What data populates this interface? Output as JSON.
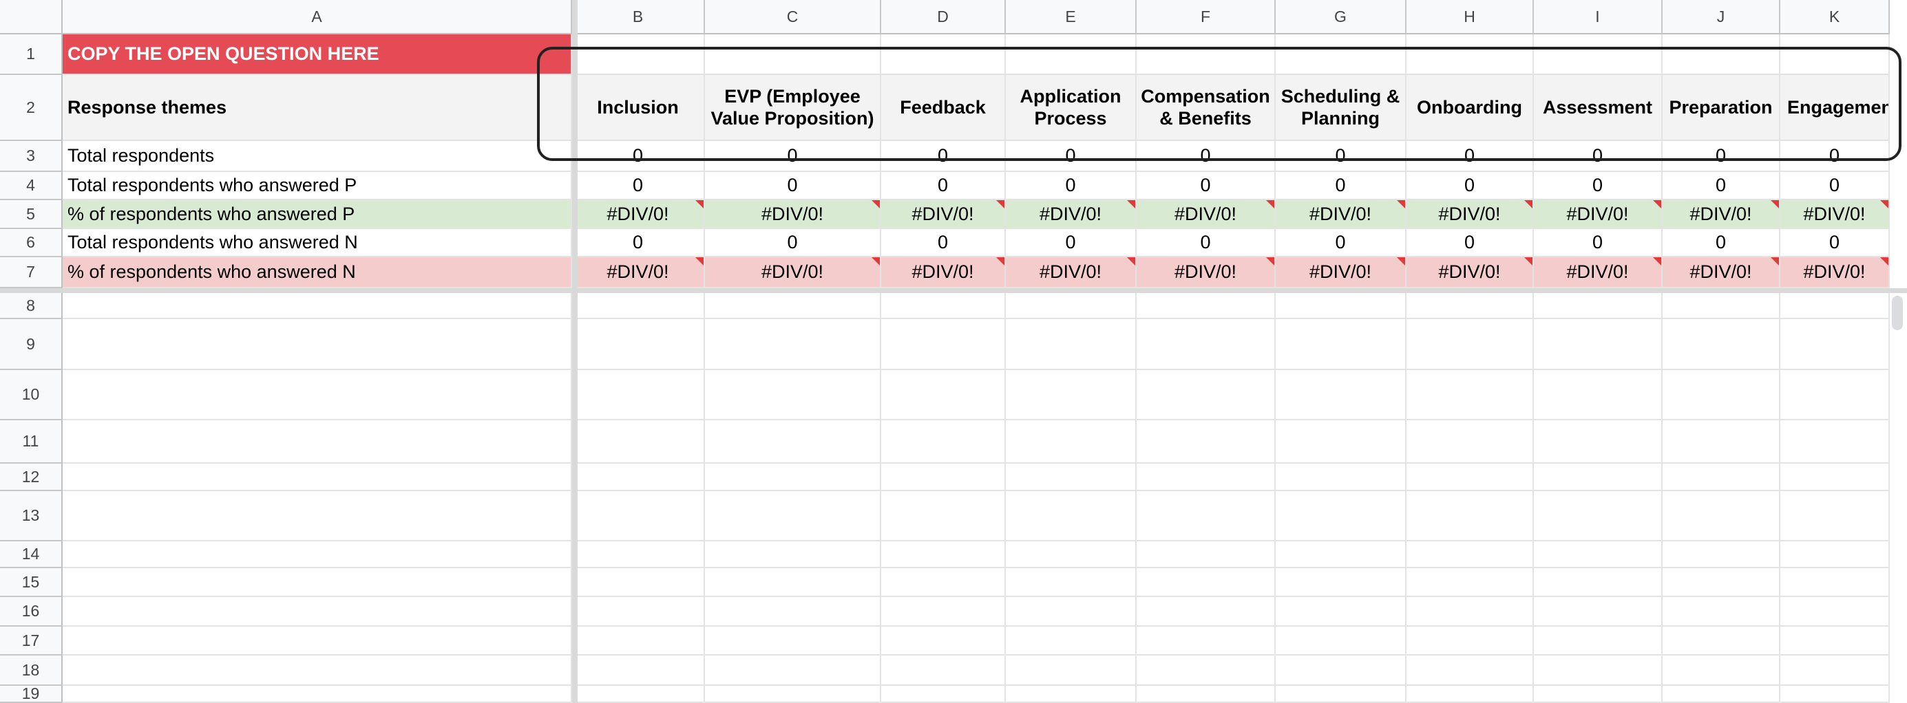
{
  "columns": [
    "A",
    "B",
    "C",
    "D",
    "E",
    "F",
    "G",
    "H",
    "I",
    "J",
    "K"
  ],
  "rows": [
    "1",
    "2",
    "3",
    "4",
    "5",
    "6",
    "7",
    "8",
    "9",
    "10",
    "11",
    "12",
    "13",
    "14",
    "15",
    "16",
    "17",
    "18",
    "19"
  ],
  "row1": {
    "A": "COPY THE OPEN QUESTION HERE"
  },
  "row2": {
    "A": "Response themes",
    "B": "Inclusion",
    "C": "EVP (Employee Value Proposition)",
    "D": "Feedback",
    "E": "Application Process",
    "F": "Compensation & Benefits",
    "G": "Scheduling & Planning",
    "H": "Onboarding",
    "I": "Assessment",
    "J": "Preparation",
    "K": "Engagemen"
  },
  "row3": {
    "A": "Total respondents",
    "values": [
      "0",
      "0",
      "0",
      "0",
      "0",
      "0",
      "0",
      "0",
      "0",
      "0"
    ]
  },
  "row4": {
    "A": "Total respondents who answered P",
    "values": [
      "0",
      "0",
      "0",
      "0",
      "0",
      "0",
      "0",
      "0",
      "0",
      "0"
    ]
  },
  "row5": {
    "A": "% of respondents who answered P",
    "values": [
      "#DIV/0!",
      "#DIV/0!",
      "#DIV/0!",
      "#DIV/0!",
      "#DIV/0!",
      "#DIV/0!",
      "#DIV/0!",
      "#DIV/0!",
      "#DIV/0!",
      "#DIV/0!"
    ]
  },
  "row6": {
    "A": "Total respondents who answered N",
    "values": [
      "0",
      "0",
      "0",
      "0",
      "0",
      "0",
      "0",
      "0",
      "0",
      "0"
    ]
  },
  "row7": {
    "A": "% of respondents who answered N",
    "values": [
      "#DIV/0!",
      "#DIV/0!",
      "#DIV/0!",
      "#DIV/0!",
      "#DIV/0!",
      "#DIV/0!",
      "#DIV/0!",
      "#DIV/0!",
      "#DIV/0!",
      "#DIV/0!"
    ]
  },
  "colors": {
    "title_fill": "#e54b55",
    "title_text": "#ffffff",
    "header_fill": "#f3f3f3",
    "p_fill": "#d9ead3",
    "n_fill": "#f4cccc",
    "error_marker": "#e03a3a",
    "annotation_box": "#222222"
  }
}
